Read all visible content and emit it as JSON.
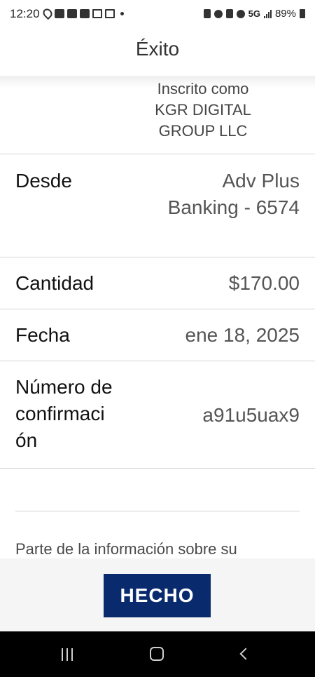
{
  "status_bar": {
    "time": "12:20",
    "network": "5G",
    "battery": "89%"
  },
  "header": {
    "title": "Éxito"
  },
  "registered": {
    "line1": "Inscrito como",
    "line2": "KGR DIGITAL",
    "line3": "GROUP LLC"
  },
  "details": {
    "from_label": "Desde",
    "from_value_line1": "Adv Plus",
    "from_value_line2": "Banking - 6574",
    "amount_label": "Cantidad",
    "amount_value": "$170.00",
    "date_label": "Fecha",
    "date_value": "ene 18, 2025",
    "confirmation_label_line1": "Número de",
    "confirmation_label_line2": "confirmaci",
    "confirmation_label_line3": "ón",
    "confirmation_value": "a91u5uax9"
  },
  "info_text": "Parte de la información sobre su",
  "done_button_label": "HECHO",
  "colors": {
    "button": "#0a2a6e",
    "divider": "#d6d6d6",
    "nav_bar": "#000000"
  }
}
